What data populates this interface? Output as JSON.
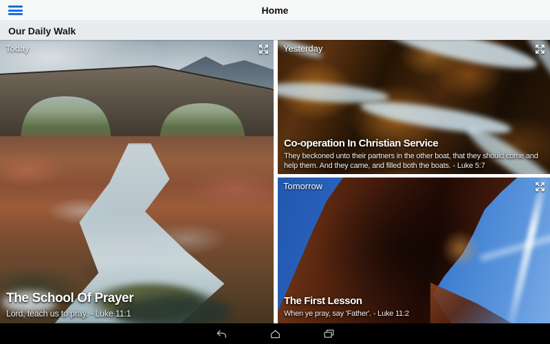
{
  "header": {
    "title": "Home",
    "section_title": "Our Daily Walk"
  },
  "cards": [
    {
      "badge": "Today",
      "title": "The School Of Prayer",
      "subtitle": "Lord, teach us to pray. - Luke 11:1"
    },
    {
      "badge": "Yesterday",
      "title": "Co-operation In Christian Service",
      "subtitle": "They beckoned unto their partners in the other boat, that they should come and help them. And they came, and filled both the boats. - Luke 5:7"
    },
    {
      "badge": "Tomorrow",
      "title": "The First Lesson",
      "subtitle": "When ye pray, say 'Father'. - Luke 11:2"
    }
  ],
  "icons": {
    "menu": "hamburger-menu-icon",
    "expand": "expand-fullscreen-icon",
    "back": "back-icon",
    "home": "home-icon",
    "recents": "recent-apps-icon"
  },
  "colors": {
    "accent_blue": "#1a6ce0",
    "topbar_bg": "#f7f8f8",
    "section_bg": "#e8ebee",
    "nav_bg": "#000000",
    "nav_icon": "#b3b7b7"
  }
}
